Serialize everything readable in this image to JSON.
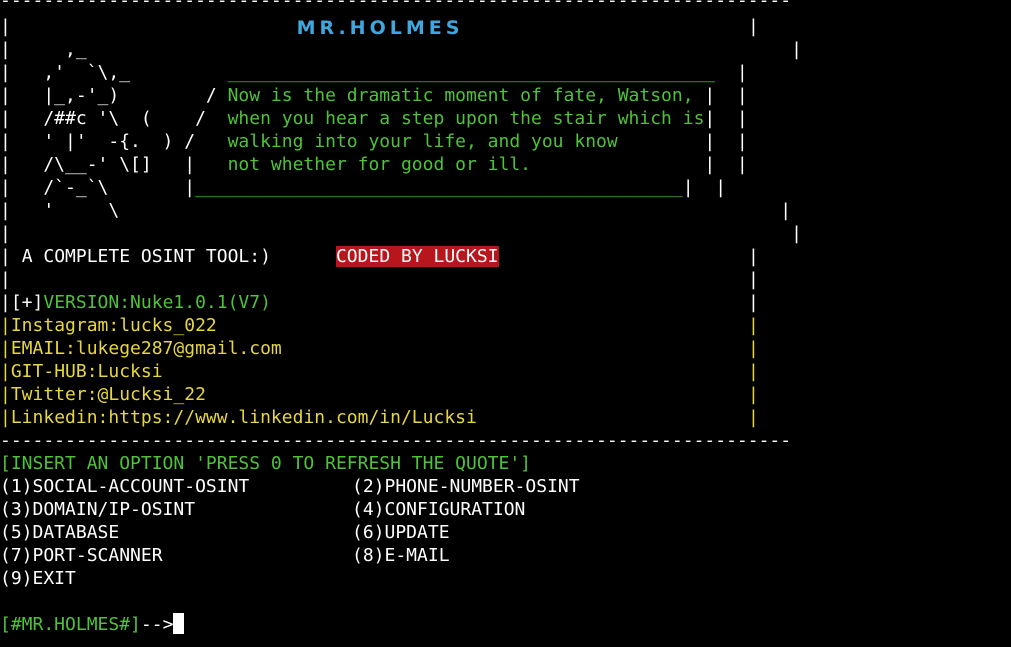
{
  "banner": {
    "top_rule": "-------------------------------------------------------------------------",
    "title": "MR.HOLMES",
    "edge_left": "|",
    "edge_right": "|"
  },
  "art": {
    "row1": "|     ,_                                                                 |",
    "row2_art": "|   ,'  `\\,_         ",
    "row2_text": "_____________________________________________",
    "row2_end": "  |",
    "row3_art": "|   |_,-'_)        / ",
    "row3_text": "Now is the dramatic moment of fate, Watson,",
    "row3_end": " |  |",
    "row4_art": "|   /##c '\\  (    /  ",
    "row4_text": "when you hear a step upon the stair which is",
    "row4_end": "|  |",
    "row5_art": "|   ' |'  -{.  ) /   ",
    "row5_text": "walking into your life, and you know       ",
    "row5_end": " |  |",
    "row6_art": "|   /\\__-' \\[]   |   ",
    "row6_text": "not whether for good or ill.               ",
    "row6_end": " |  |",
    "row7_art": "|   /`-_`\\       |",
    "row7_text": "_____________________________________________",
    "row7_end": "|  |",
    "row8": "|   '     \\                                                             |",
    "row9": "|                                                                        |"
  },
  "header": {
    "tagline": "A COMPLETE OSINT TOOL:)",
    "coded_by": "CODED BY LUCKSI"
  },
  "info": {
    "version_prefix": "[+]",
    "version": "VERSION:Nuke1.0.1(V7)",
    "instagram": "Instagram:lucks_022",
    "email": "EMAIL:lukege287@gmail.com",
    "github": "GIT-HUB:Lucksi",
    "twitter": "Twitter:@Lucksi_22",
    "linkedin": "Linkedin:https://www.linkedin.com/in/Lucksi"
  },
  "menu": {
    "instruction": "[INSERT AN OPTION 'PRESS 0 TO REFRESH THE QUOTE']",
    "options": [
      "(1)SOCIAL-ACCOUNT-OSINT",
      "(2)PHONE-NUMBER-OSINT",
      "(3)DOMAIN/IP-OSINT",
      "(4)CONFIGURATION",
      "(5)DATABASE",
      "(6)UPDATE",
      "(7)PORT-SCANNER",
      "(8)E-MAIL",
      "(9)EXIT"
    ]
  },
  "prompt": {
    "label": "[#MR.HOLMES#]",
    "arrow": "-->"
  },
  "colors": {
    "background": "#000000",
    "green": "#4fc23a",
    "yellow": "#e6d642",
    "cyan": "#3fa7dd",
    "red_badge": "#b8161d"
  }
}
